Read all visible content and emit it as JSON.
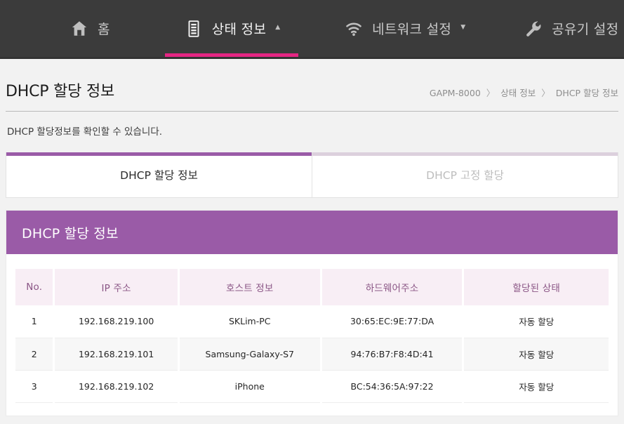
{
  "nav": {
    "items": [
      {
        "label": "홈",
        "icon": "home-icon",
        "has_caret": false,
        "active": false
      },
      {
        "label": "상태 정보",
        "icon": "document-list-icon",
        "has_caret": true,
        "caret": "▲",
        "active": true
      },
      {
        "label": "네트워크 설정",
        "icon": "wifi-icon",
        "has_caret": true,
        "caret": "▼",
        "active": false
      },
      {
        "label": "공유기 설정",
        "icon": "wrench-icon",
        "has_caret": true,
        "caret": "▼",
        "active": false
      }
    ],
    "accent_color": "#e52583",
    "background_color": "#3b3b3b"
  },
  "page": {
    "title": "DHCP 할당 정보",
    "description": "DHCP 할당정보를 확인할 수 있습니다.",
    "breadcrumb": {
      "device": "GAPM-8000",
      "section": "상태 정보",
      "current": "DHCP 할당 정보",
      "separator": "〉"
    }
  },
  "tabs": [
    {
      "label": "DHCP 할당 정보",
      "active": true
    },
    {
      "label": "DHCP 고정 할당",
      "active": false
    }
  ],
  "panel": {
    "title": "DHCP 할당 정보",
    "header_color": "#9a5ba7",
    "table": {
      "headers": [
        "No.",
        "IP 주소",
        "호스트 정보",
        "하드웨어주소",
        "할당된 상태"
      ],
      "rows": [
        {
          "no": "1",
          "ip": "192.168.219.100",
          "host": "SKLim-PC",
          "mac": "30:65:EC:9E:77:DA",
          "state": "자동 할당"
        },
        {
          "no": "2",
          "ip": "192.168.219.101",
          "host": "Samsung-Galaxy-S7",
          "mac": "94:76:B7:F8:4D:41",
          "state": "자동 할당"
        },
        {
          "no": "3",
          "ip": "192.168.219.102",
          "host": "iPhone",
          "mac": "BC:54:36:5A:97:22",
          "state": "자동 할당"
        }
      ]
    }
  }
}
